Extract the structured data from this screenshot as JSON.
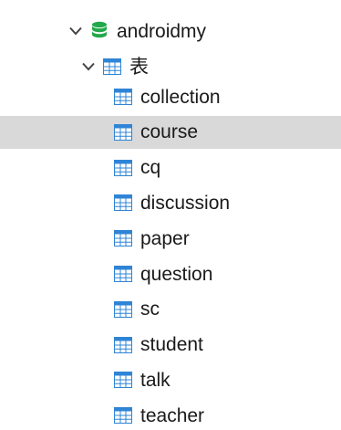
{
  "tree": {
    "database": {
      "label": "androidmy",
      "expanded": true
    },
    "group": {
      "label": "表",
      "expanded": true
    },
    "tables": [
      {
        "label": "collection",
        "selected": false
      },
      {
        "label": "course",
        "selected": true
      },
      {
        "label": "cq",
        "selected": false
      },
      {
        "label": "discussion",
        "selected": false
      },
      {
        "label": "paper",
        "selected": false
      },
      {
        "label": "question",
        "selected": false
      },
      {
        "label": "sc",
        "selected": false
      },
      {
        "label": "student",
        "selected": false
      },
      {
        "label": "talk",
        "selected": false
      },
      {
        "label": "teacher",
        "selected": false
      }
    ]
  },
  "colors": {
    "database_icon": "#22a84a",
    "table_icon": "#2f84d6",
    "selection": "#d9d9d9",
    "chevron": "#444444"
  }
}
